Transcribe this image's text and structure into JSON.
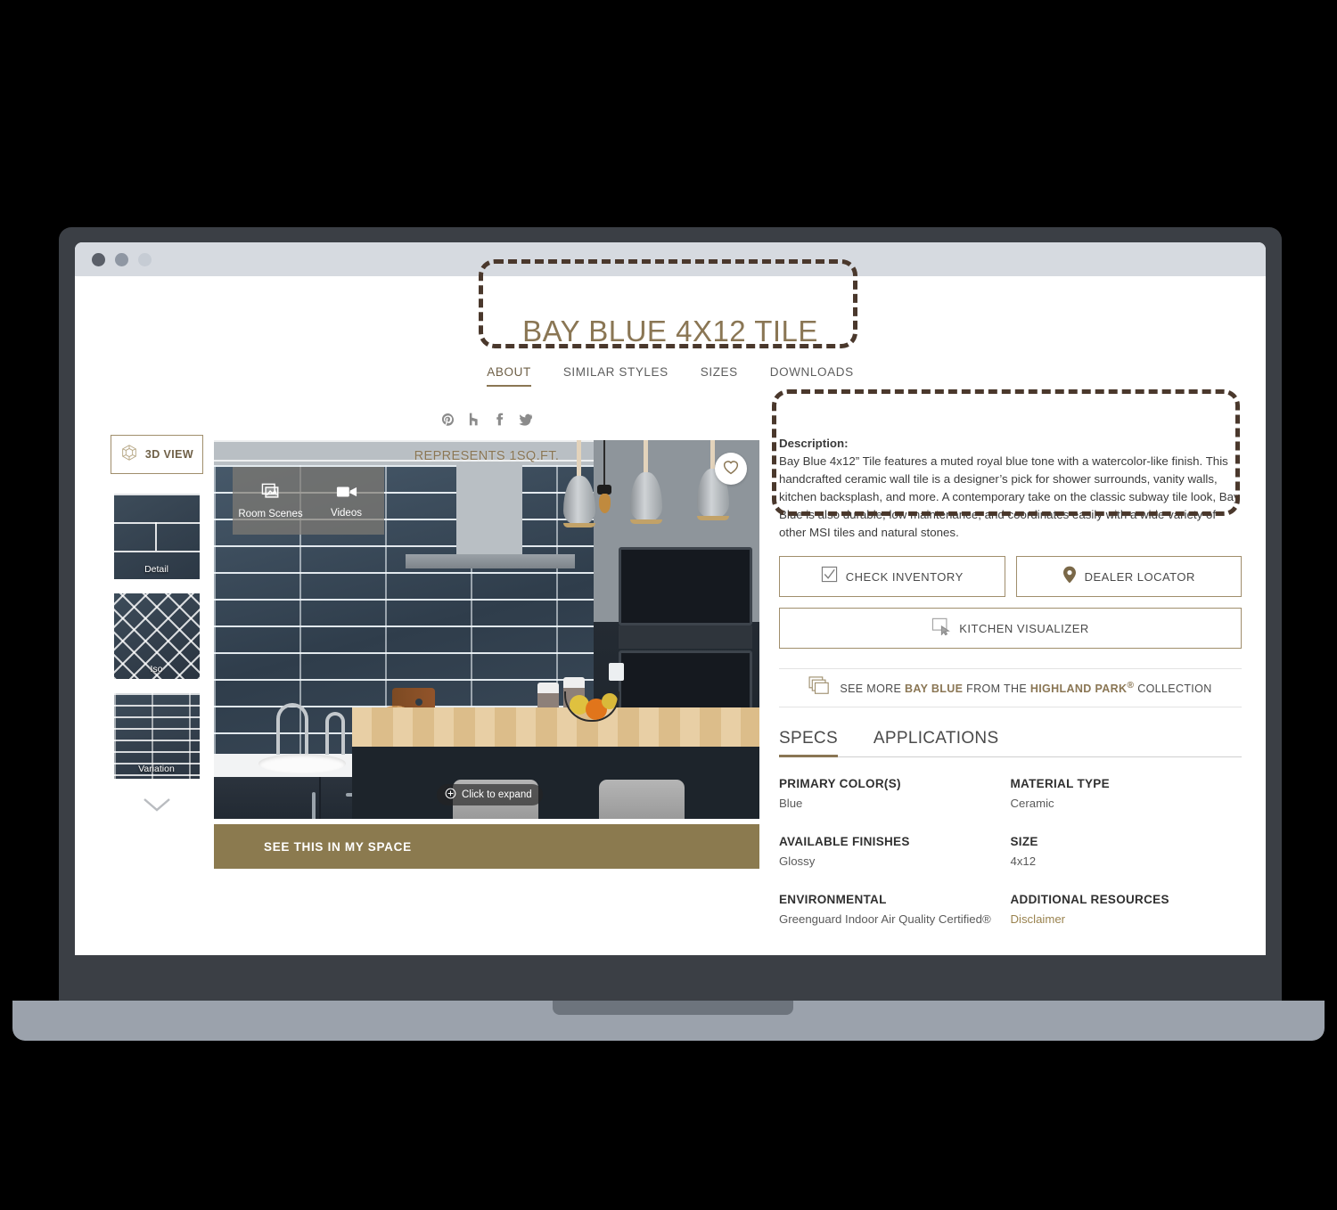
{
  "browser": {
    "dots": [
      "window-close-dot",
      "window-minimize-dot",
      "window-maximize-dot"
    ]
  },
  "header": {
    "title": "BAY BLUE 4X12 TILE",
    "nav": [
      {
        "label": "ABOUT",
        "active": true
      },
      {
        "label": "SIMILAR STYLES",
        "active": false
      },
      {
        "label": "SIZES",
        "active": false
      },
      {
        "label": "DOWNLOADS",
        "active": false
      }
    ]
  },
  "left_rail": {
    "view_3d_label": "3D VIEW",
    "thumbnails": [
      {
        "caption": "Detail"
      },
      {
        "caption": "Iso"
      },
      {
        "caption": "Variation"
      }
    ]
  },
  "gallery": {
    "social": [
      "pinterest-icon",
      "houzz-icon",
      "facebook-icon",
      "twitter-icon"
    ],
    "represents_label": "REPRESENTS 1SQ.FT.",
    "media_buttons": [
      {
        "label": "Room Scenes",
        "icon": "photo-stack-icon"
      },
      {
        "label": "Videos",
        "icon": "video-camera-icon"
      }
    ],
    "favorite_icon": "heart-icon",
    "expand_label": "Click to expand",
    "expand_icon": "plus-circle-icon",
    "see_in_space_label": "SEE THIS IN MY SPACE"
  },
  "description": {
    "heading": "Description:",
    "body": "Bay Blue 4x12” Tile features a muted royal blue tone with a watercolor-like finish. This handcrafted ceramic wall tile is a designer’s pick for shower surrounds, vanity walls, kitchen backsplash, and more. A contemporary take on the classic subway tile look, Bay Blue is also durable, low maintenance, and coordinates easily with a wide variety of other MSI tiles and natural stones."
  },
  "actions": [
    {
      "label": "CHECK INVENTORY",
      "icon": "checkbox-icon"
    },
    {
      "label": "DEALER LOCATOR",
      "icon": "map-pin-icon"
    },
    {
      "label": "KITCHEN VISUALIZER",
      "icon": "visualizer-cursor-icon"
    }
  ],
  "collection_link": {
    "icon": "stacked-squares-icon",
    "prefix": "SEE MORE ",
    "product": "BAY BLUE",
    "middle": " FROM THE ",
    "collection": "HIGHLAND PARK",
    "registered": "®",
    "suffix": " COLLECTION"
  },
  "spec_tabs": [
    {
      "label": "SPECS",
      "active": true
    },
    {
      "label": "APPLICATIONS",
      "active": false
    }
  ],
  "specs": [
    {
      "label": "PRIMARY COLOR(S)",
      "value": "Blue",
      "link": false
    },
    {
      "label": "MATERIAL TYPE",
      "value": "Ceramic",
      "link": false
    },
    {
      "label": "AVAILABLE FINISHES",
      "value": "Glossy",
      "link": false
    },
    {
      "label": "SIZE",
      "value": "4x12",
      "link": false
    },
    {
      "label": "ENVIRONMENTAL",
      "value": "Greenguard Indoor Air Quality Certified®",
      "link": false
    },
    {
      "label": "ADDITIONAL RESOURCES",
      "value": "Disclaimer",
      "link": true
    }
  ],
  "colors": {
    "gold_accent": "#8a7654",
    "gold_border": "#a08e6c",
    "cta_gold": "#8b7a4f",
    "annotation_brown": "#4a382c",
    "laptop_body": "#3b3f45",
    "laptop_base": "#9ba2ac",
    "chrome_bar": "#d6dae0",
    "tile_blue": "#3b4a59"
  }
}
